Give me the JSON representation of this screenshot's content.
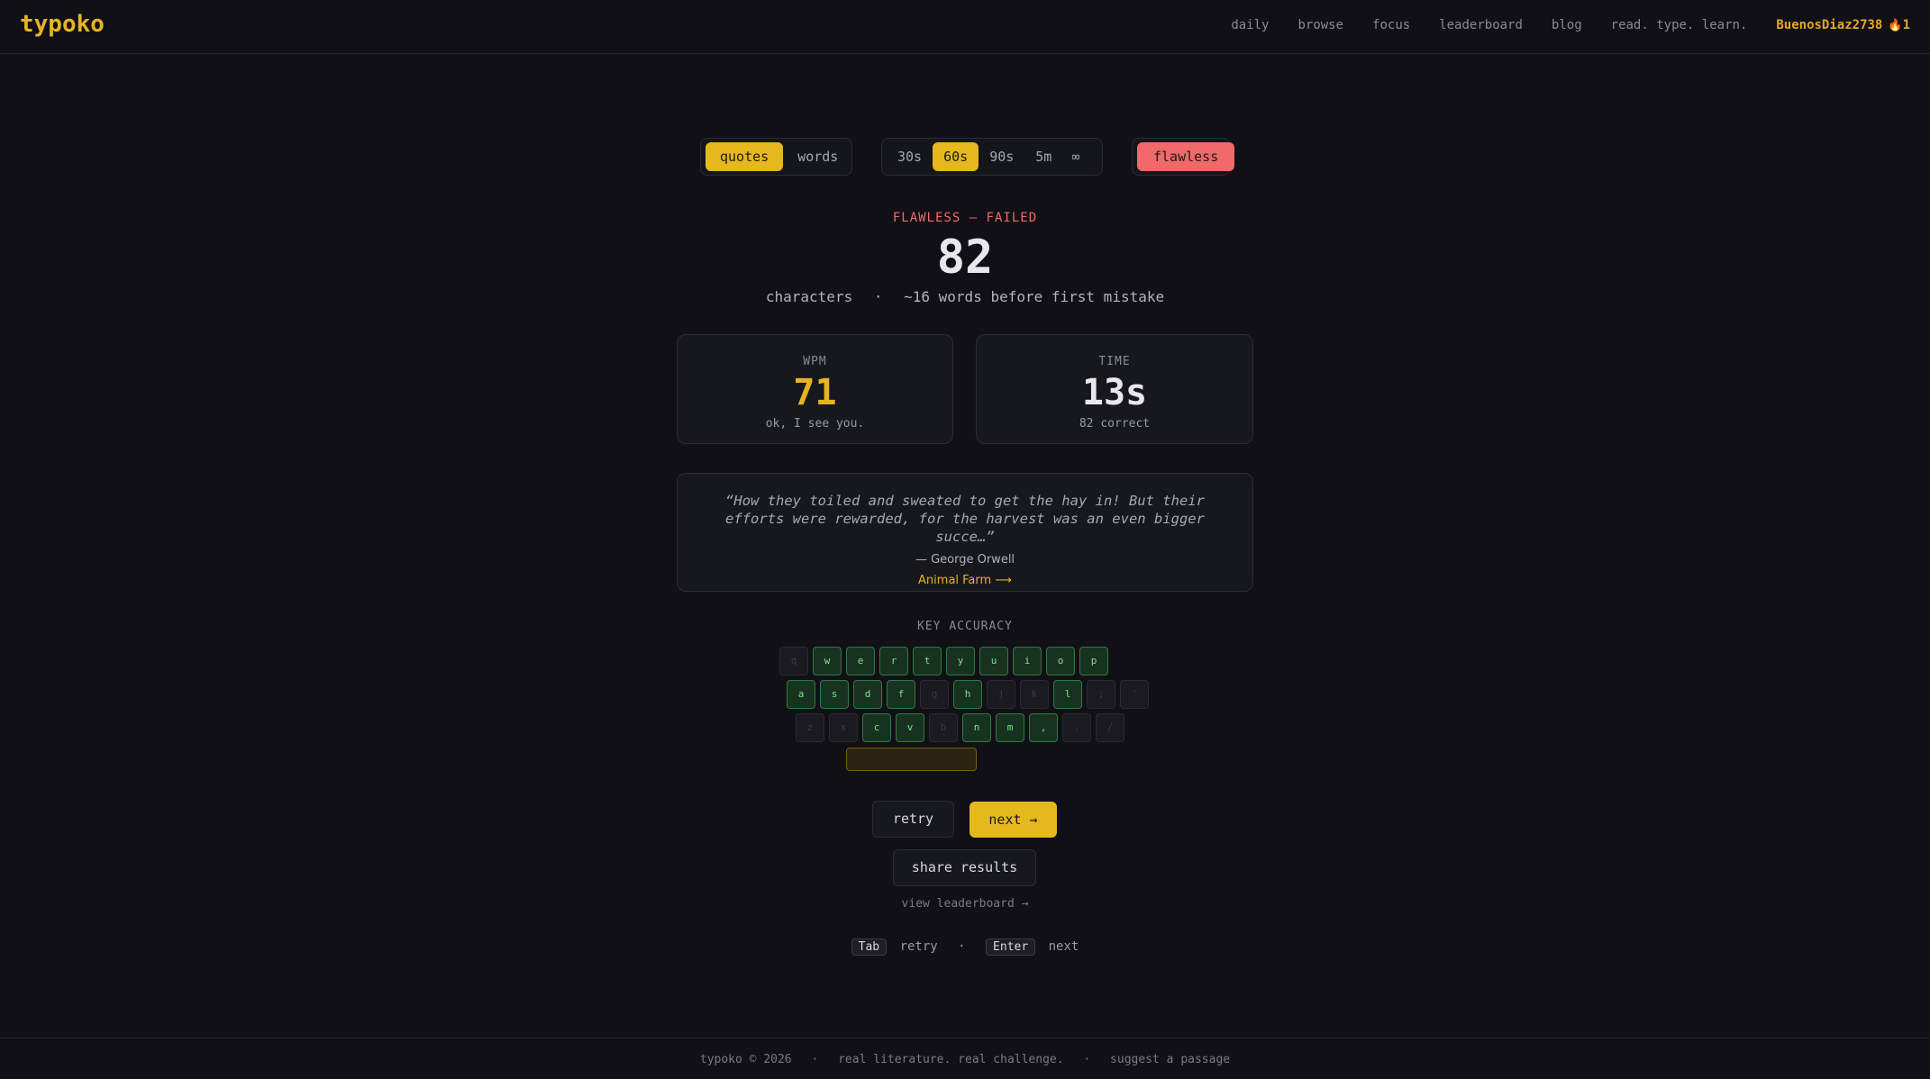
{
  "brand": {
    "logo": "typoko"
  },
  "nav": {
    "links": [
      "daily",
      "browse",
      "focus",
      "leaderboard",
      "blog",
      "read. type. learn."
    ],
    "user": "BuenosDiaz2738",
    "streak": "1"
  },
  "modes": {
    "quotes": "quotes",
    "words": "words",
    "selected": "quotes"
  },
  "durations": {
    "d30": "30s",
    "d60": "60s",
    "d90": "90s",
    "d5m": "5m",
    "inf": "∞",
    "selected": "60s"
  },
  "flawless": {
    "label": "flawless"
  },
  "result": {
    "status": "FLAWLESS — FAILED",
    "characters": "82",
    "characters_label": "characters",
    "sep": "·",
    "words_before": "~16 words before first mistake"
  },
  "stats": {
    "wpm": {
      "label": "WPM",
      "value": "71",
      "note": "ok, I see you."
    },
    "time": {
      "label": "TIME",
      "value": "13s",
      "note": "82 correct"
    }
  },
  "quote": {
    "text": "“How they toiled and sweated to get the hay in! But their efforts were rewarded, for the harvest was an even bigger succe…”",
    "author": "— George Orwell",
    "book": "Animal Farm ⟶"
  },
  "key_accuracy": {
    "title": "KEY ACCURACY",
    "rows": [
      [
        {
          "k": "q",
          "hit": false
        },
        {
          "k": "w",
          "hit": true
        },
        {
          "k": "e",
          "hit": true
        },
        {
          "k": "r",
          "hit": true
        },
        {
          "k": "t",
          "hit": true
        },
        {
          "k": "y",
          "hit": true
        },
        {
          "k": "u",
          "hit": true
        },
        {
          "k": "i",
          "hit": true
        },
        {
          "k": "o",
          "hit": true
        },
        {
          "k": "p",
          "hit": true
        }
      ],
      [
        {
          "k": "a",
          "hit": true
        },
        {
          "k": "s",
          "hit": true
        },
        {
          "k": "d",
          "hit": true
        },
        {
          "k": "f",
          "hit": true
        },
        {
          "k": "g",
          "hit": false
        },
        {
          "k": "h",
          "hit": true
        },
        {
          "k": "j",
          "hit": false
        },
        {
          "k": "k",
          "hit": false
        },
        {
          "k": "l",
          "hit": true
        },
        {
          "k": ";",
          "hit": false
        },
        {
          "k": "'",
          "hit": false
        }
      ],
      [
        {
          "k": "z",
          "hit": false
        },
        {
          "k": "x",
          "hit": false
        },
        {
          "k": "c",
          "hit": true
        },
        {
          "k": "v",
          "hit": true
        },
        {
          "k": "b",
          "hit": false
        },
        {
          "k": "n",
          "hit": true
        },
        {
          "k": "m",
          "hit": true
        },
        {
          "k": ",",
          "hit": true
        },
        {
          "k": ".",
          "hit": false
        },
        {
          "k": "/",
          "hit": false
        }
      ]
    ]
  },
  "actions": {
    "retry": "retry",
    "next": "next →",
    "share": "share results",
    "leaderboard": "view leaderboard →"
  },
  "shortcuts": {
    "tab_key": "Tab",
    "tab_action": "retry",
    "sep": "·",
    "enter_key": "Enter",
    "enter_action": "next"
  },
  "footer": {
    "copyright": "typoko © 2026",
    "tagline": "real literature. real challenge.",
    "suggest": "suggest a passage",
    "sep": "·"
  },
  "colors": {
    "accent": "#e6b81c",
    "danger": "#f06a6a",
    "good": "#7ee08e",
    "background": "#101016"
  }
}
